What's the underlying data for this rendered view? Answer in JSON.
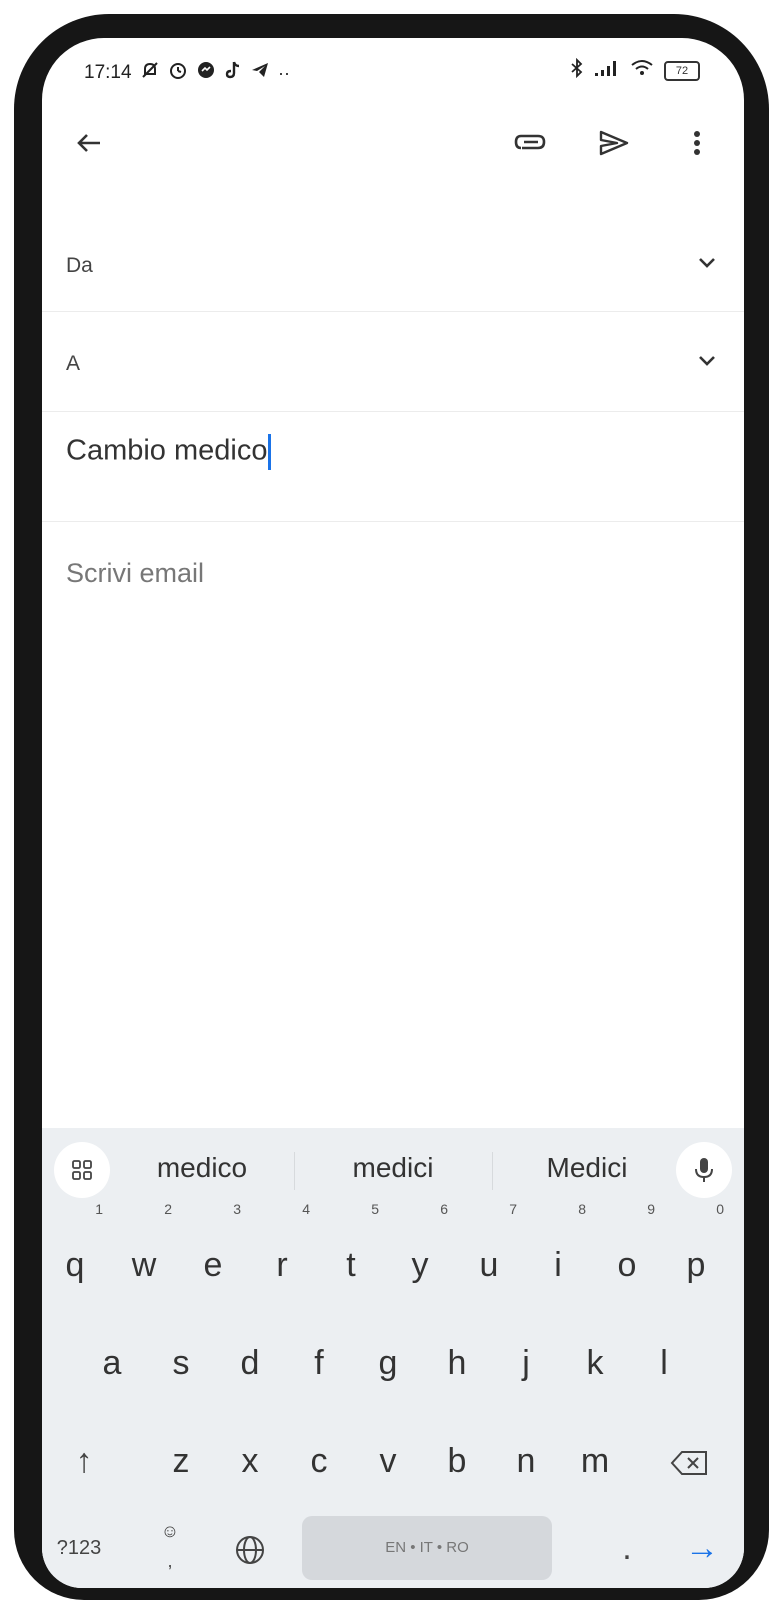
{
  "status_bar": {
    "time": "17:14",
    "notification_icons": [
      "notifications-off-icon",
      "alarm-icon",
      "messenger-icon",
      "tiktok-icon",
      "telegram-icon",
      "more-notifications-icon"
    ],
    "more_dots": "··",
    "system_icons": [
      "bluetooth-icon",
      "signal-icon",
      "wifi-icon",
      "battery-icon"
    ],
    "battery_level": "72"
  },
  "app_bar": {
    "icons": [
      "back-arrow-icon",
      "attach-icon",
      "send-icon",
      "more-vert-icon"
    ]
  },
  "compose": {
    "from_label": "Da",
    "to_label": "A",
    "subject_value": "Cambio medico",
    "body_placeholder": "Scrivi email"
  },
  "keyboard": {
    "suggestions": [
      "medico",
      "medici",
      "Medici"
    ],
    "row1": [
      {
        "key": "q",
        "hint": "1"
      },
      {
        "key": "w",
        "hint": "2"
      },
      {
        "key": "e",
        "hint": "3"
      },
      {
        "key": "r",
        "hint": "4"
      },
      {
        "key": "t",
        "hint": "5"
      },
      {
        "key": "y",
        "hint": "6"
      },
      {
        "key": "u",
        "hint": "7"
      },
      {
        "key": "i",
        "hint": "8"
      },
      {
        "key": "o",
        "hint": "9"
      },
      {
        "key": "p",
        "hint": "0"
      }
    ],
    "row2": [
      "a",
      "s",
      "d",
      "f",
      "g",
      "h",
      "j",
      "k",
      "l"
    ],
    "row3": [
      "z",
      "x",
      "c",
      "v",
      "b",
      "n",
      "m"
    ],
    "shift_symbol": "↑",
    "numbers_label": "?123",
    "emoji_symbol": "☺",
    "comma_label": ",",
    "space_label": "EN • IT • RO",
    "period_label": ".",
    "enter_symbol": "→"
  }
}
